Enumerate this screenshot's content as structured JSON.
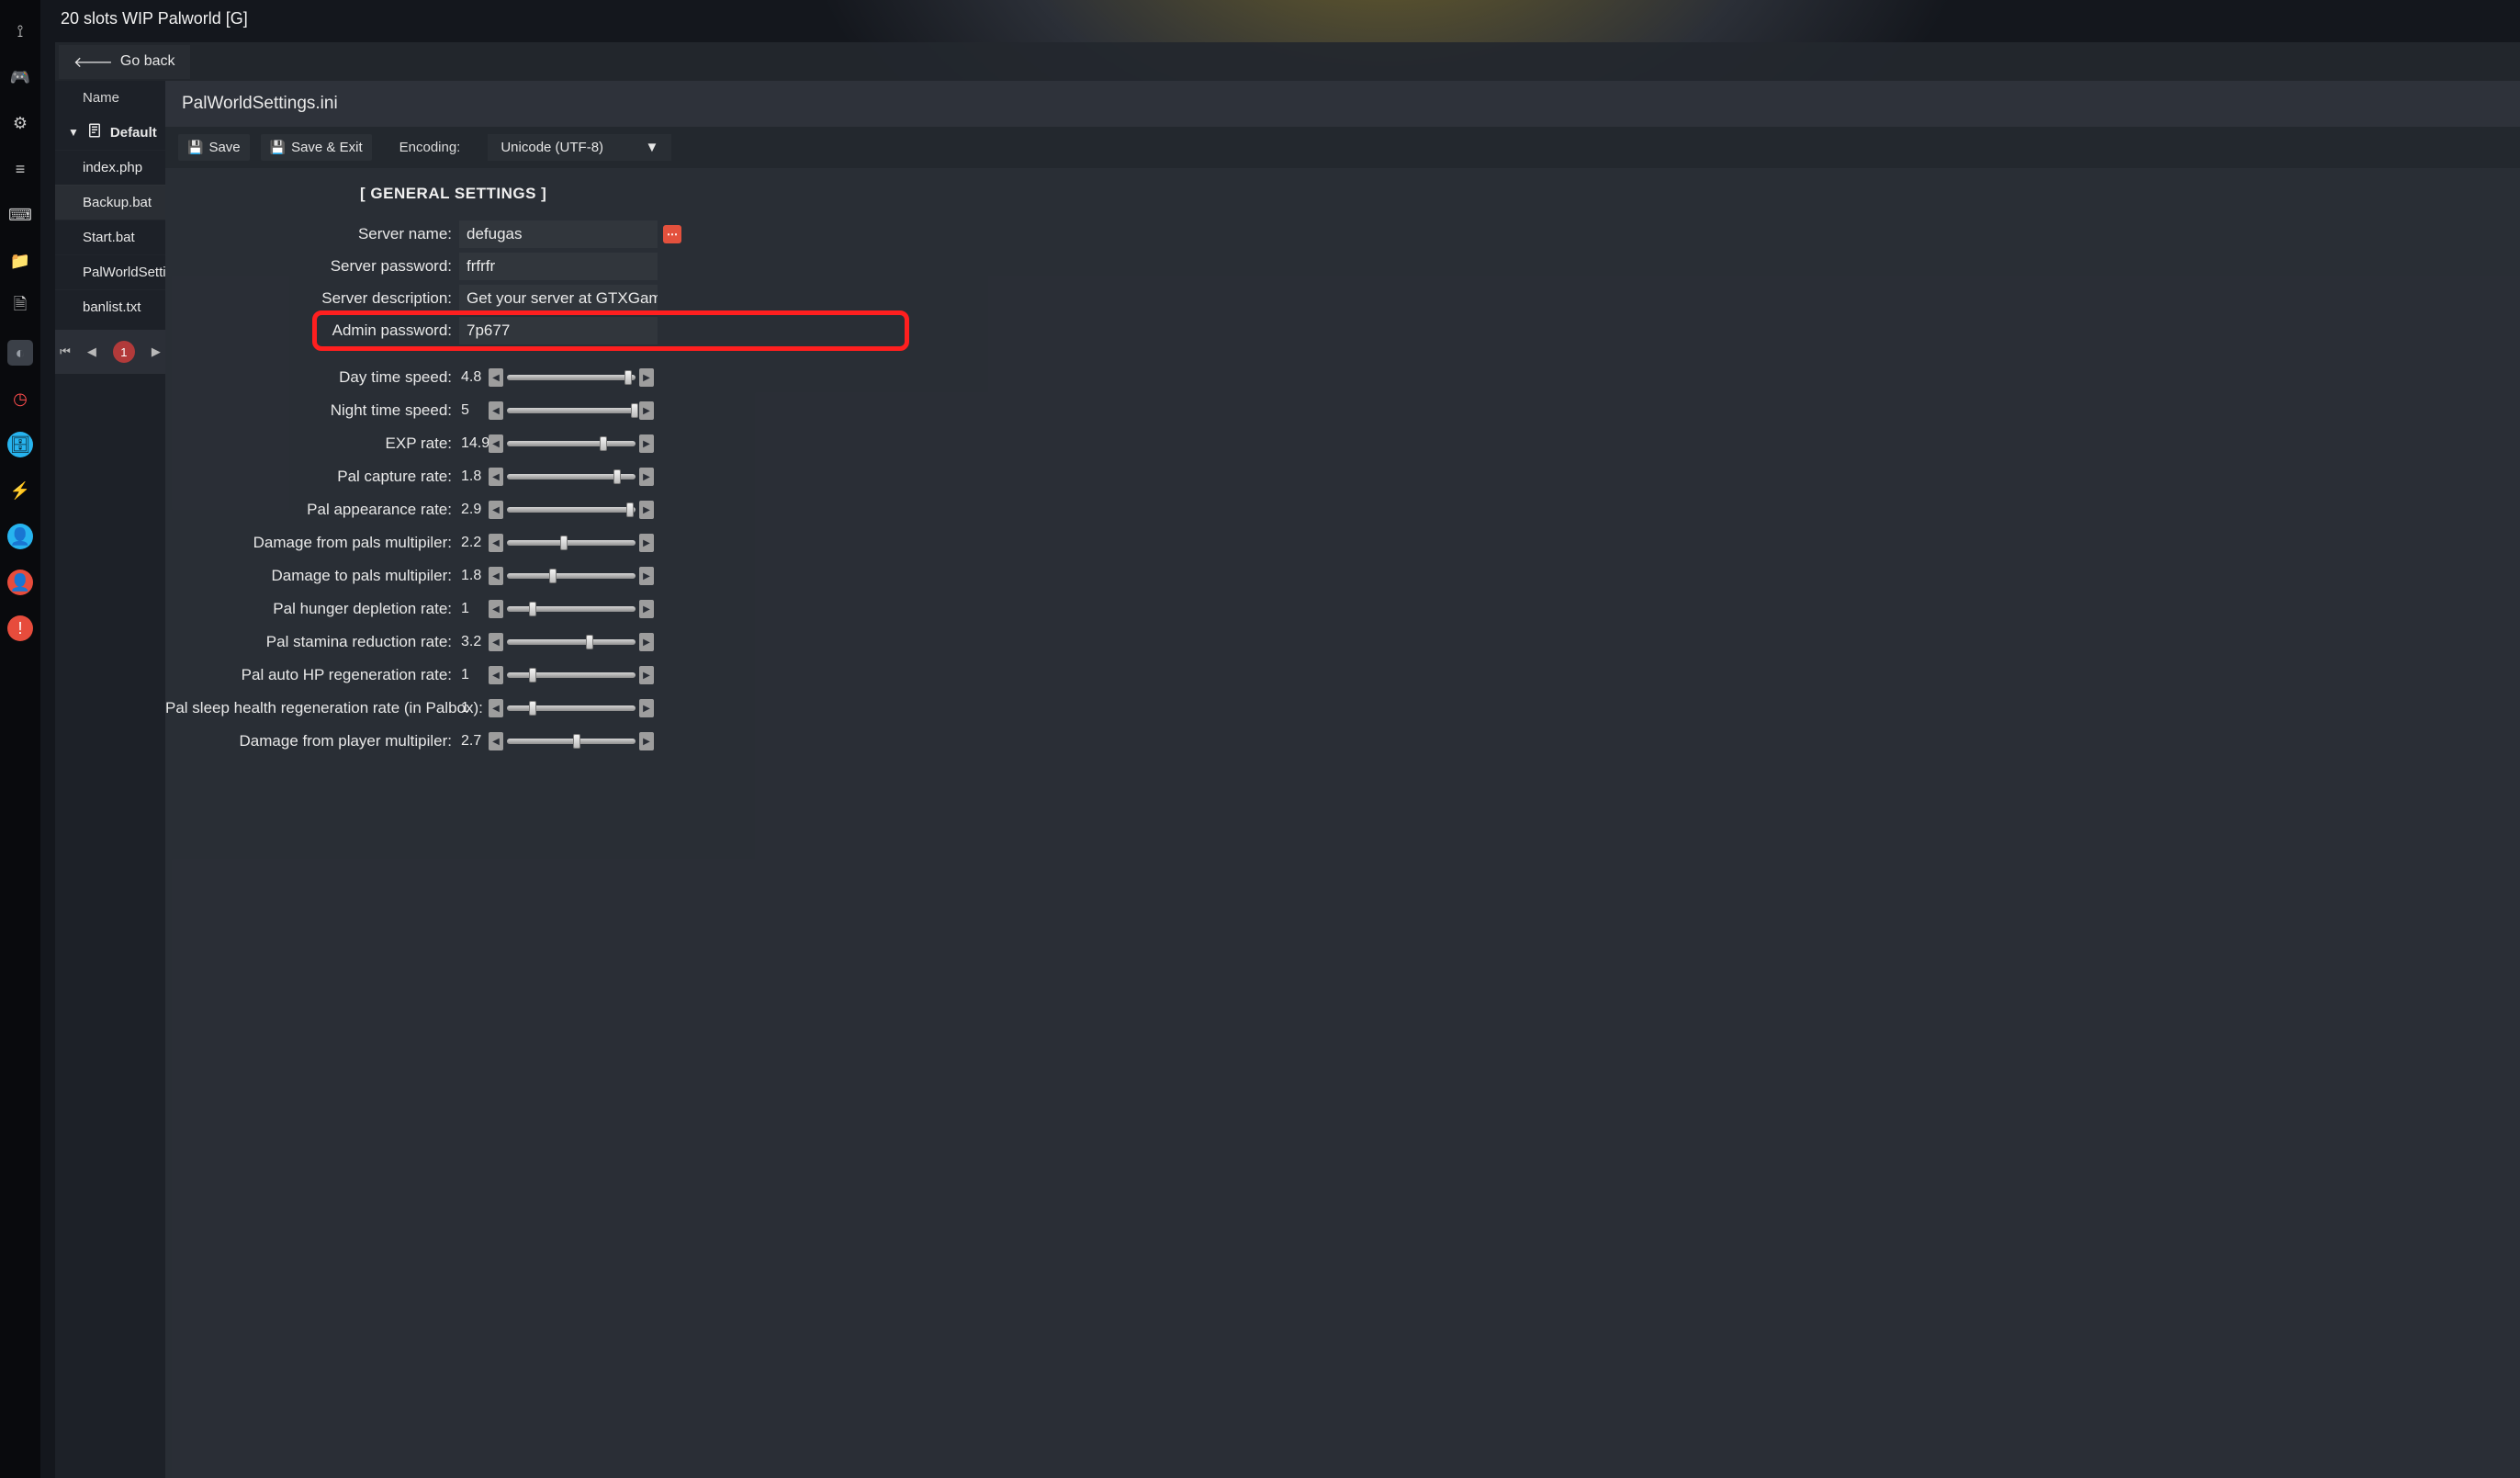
{
  "header": {
    "title": "20 slots WIP Palworld [G]"
  },
  "goback": {
    "label": "Go back"
  },
  "files": {
    "header": "Name",
    "folder": "Default",
    "items": [
      "index.php",
      "Backup.bat",
      "Start.bat",
      "PalWorldSettin",
      "banlist.txt"
    ],
    "selected_index": 1,
    "pager_page": "1"
  },
  "editor": {
    "filename": "PalWorldSettings.ini",
    "save_label": "Save",
    "save_exit_label": "Save & Exit",
    "encoding_label": "Encoding:",
    "encoding_value": "Unicode (UTF-8)"
  },
  "section": {
    "title": "[ GENERAL SETTINGS ]"
  },
  "text_fields": [
    {
      "label": "Server name:",
      "value": "defugas",
      "action_button": true
    },
    {
      "label": "Server password:",
      "value": "frfrfr"
    },
    {
      "label": "Server description:",
      "value": "Get your server at GTXGaming.c"
    },
    {
      "label": "Admin password:",
      "value": "7p677",
      "highlight": true
    }
  ],
  "sliders": [
    {
      "label": "Day time speed:",
      "value": "4.8",
      "pct": 94
    },
    {
      "label": "Night time speed:",
      "value": "5",
      "pct": 99
    },
    {
      "label": "EXP rate:",
      "value": "14.9",
      "pct": 75
    },
    {
      "label": "Pal capture rate:",
      "value": "1.8",
      "pct": 86
    },
    {
      "label": "Pal appearance rate:",
      "value": "2.9",
      "pct": 96
    },
    {
      "label": "Damage from pals multipiler:",
      "value": "2.2",
      "pct": 44
    },
    {
      "label": "Damage to pals multipiler:",
      "value": "1.8",
      "pct": 36
    },
    {
      "label": "Pal hunger depletion rate:",
      "value": "1",
      "pct": 20
    },
    {
      "label": "Pal stamina reduction rate:",
      "value": "3.2",
      "pct": 64
    },
    {
      "label": "Pal auto HP regeneration rate:",
      "value": "1",
      "pct": 20
    },
    {
      "label": "Pal sleep health regeneration rate (in Palbox):",
      "value": "1",
      "pct": 20
    },
    {
      "label": "Damage from player multipiler:",
      "value": "2.7",
      "pct": 54
    }
  ],
  "rail_icons": [
    {
      "name": "pin-icon",
      "glyph": "⟟",
      "cls": ""
    },
    {
      "name": "gamepad-icon",
      "glyph": "🎮",
      "cls": "green"
    },
    {
      "name": "gear-icon",
      "glyph": "⚙",
      "cls": ""
    },
    {
      "name": "sliders-icon",
      "glyph": "≡",
      "cls": ""
    },
    {
      "name": "keyboard-icon",
      "glyph": "⌨",
      "cls": ""
    },
    {
      "name": "folder-icon",
      "glyph": "📁",
      "cls": "orange"
    },
    {
      "name": "file-plus-icon",
      "glyph": "🗎",
      "cls": ""
    },
    {
      "name": "steam-icon",
      "glyph": "◐",
      "cls": "darkpanel"
    },
    {
      "name": "clock-icon",
      "glyph": "◷",
      "cls": "red-ring"
    },
    {
      "name": "database-icon",
      "glyph": "🗄",
      "cls": "blue-circ"
    },
    {
      "name": "bolt-icon",
      "glyph": "⚡",
      "cls": "yellow"
    },
    {
      "name": "user-circle-icon",
      "glyph": "👤",
      "cls": "blue-circ"
    },
    {
      "name": "user-alert-icon",
      "glyph": "👤",
      "cls": "red-dot"
    },
    {
      "name": "warning-icon",
      "glyph": "!",
      "cls": "red-dot"
    }
  ]
}
